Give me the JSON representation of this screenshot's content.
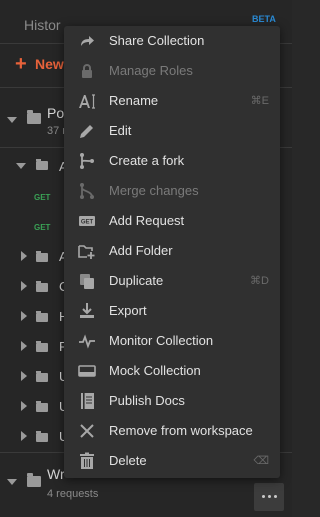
{
  "sidebar": {
    "tab_history": "Histor",
    "tab_beta": "BETA",
    "new_label": "New",
    "collection_top": {
      "name": "Po",
      "sub": "37 r"
    },
    "request_badges": [
      "GET",
      "GET"
    ],
    "folder_initials": [
      "A",
      "A",
      "C",
      "H",
      "R",
      "U",
      "U",
      "U"
    ],
    "collection_bottom": {
      "name": "Wr",
      "sub": "4 requests"
    }
  },
  "menu": {
    "items": [
      {
        "label": "Share Collection",
        "icon": "share-icon",
        "shortcut": "",
        "disabled": false
      },
      {
        "label": "Manage Roles",
        "icon": "lock-icon",
        "shortcut": "",
        "disabled": true
      },
      {
        "label": "Rename",
        "icon": "rename-icon",
        "shortcut": "⌘E",
        "disabled": false
      },
      {
        "label": "Edit",
        "icon": "pencil-icon",
        "shortcut": "",
        "disabled": false
      },
      {
        "label": "Create a fork",
        "icon": "fork-icon",
        "shortcut": "",
        "disabled": false
      },
      {
        "label": "Merge changes",
        "icon": "merge-icon",
        "shortcut": "",
        "disabled": true
      },
      {
        "label": "Add Request",
        "icon": "get-request-icon",
        "shortcut": "",
        "disabled": false
      },
      {
        "label": "Add Folder",
        "icon": "add-folder-icon",
        "shortcut": "",
        "disabled": false
      },
      {
        "label": "Duplicate",
        "icon": "duplicate-icon",
        "shortcut": "⌘D",
        "disabled": false
      },
      {
        "label": "Export",
        "icon": "export-icon",
        "shortcut": "",
        "disabled": false
      },
      {
        "label": "Monitor Collection",
        "icon": "pulse-icon",
        "shortcut": "",
        "disabled": false
      },
      {
        "label": "Mock Collection",
        "icon": "mock-server-icon",
        "shortcut": "",
        "disabled": false
      },
      {
        "label": "Publish Docs",
        "icon": "docs-icon",
        "shortcut": "",
        "disabled": false
      },
      {
        "label": "Remove from workspace",
        "icon": "close-icon",
        "shortcut": "",
        "disabled": false
      },
      {
        "label": "Delete",
        "icon": "trash-icon",
        "shortcut": "⌫",
        "disabled": false
      }
    ]
  },
  "colors": {
    "menu_bg": "#303030",
    "sidebar_bg": "#262626",
    "accent": "#e8623a",
    "get_green": "#3aa155"
  }
}
